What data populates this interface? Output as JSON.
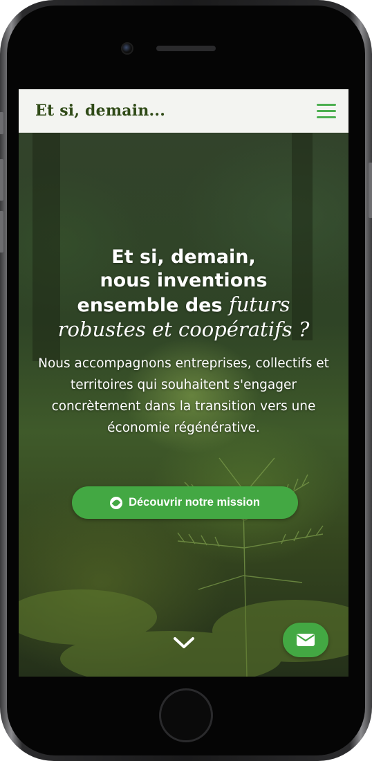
{
  "header": {
    "brand": "Et si, demain...",
    "menu_icon": "hamburger-menu-icon",
    "accent_color": "#4caf50"
  },
  "hero": {
    "title_line1": "Et si, demain,",
    "title_line2": "nous inventions",
    "title_line3_plain": "ensemble des ",
    "title_line3_italic": "futurs",
    "title_line4_italic": "robustes et coopératifs ?",
    "description": "Nous accompagnons entreprises, collectifs et territoires qui souhaitent s'engager concrètement dans la transition vers une économie régénérative.",
    "cta_label": "Découvrir notre mission",
    "cta_icon": "compass-icon",
    "scroll_icon": "chevron-down-icon",
    "contact_icon": "envelope-icon",
    "button_color": "#43a843"
  }
}
